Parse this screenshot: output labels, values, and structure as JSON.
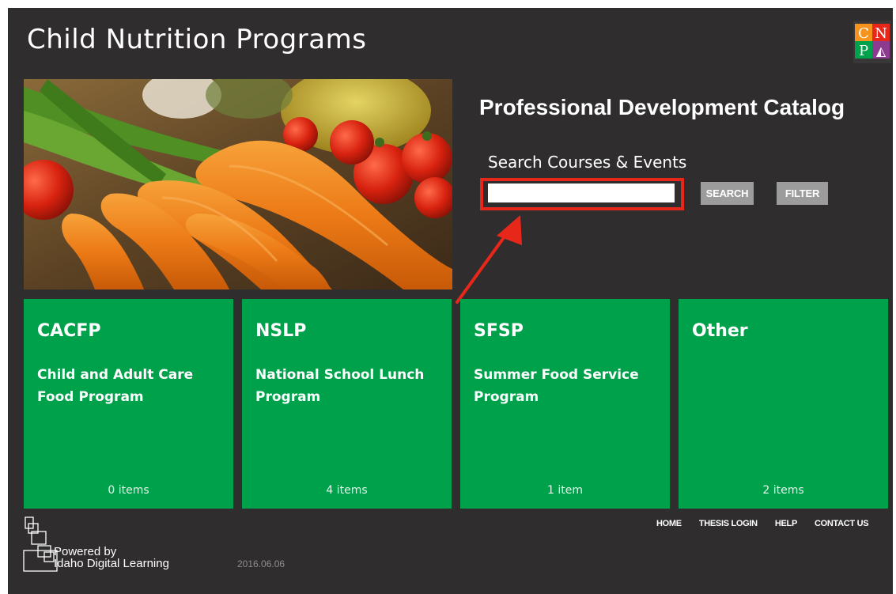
{
  "header": {
    "title": "Child Nutrition Programs"
  },
  "logo": {
    "letters": [
      "C",
      "N",
      "P",
      "◭"
    ]
  },
  "catalog": {
    "title": "Professional Development Catalog"
  },
  "search": {
    "label": "Search Courses & Events",
    "value": "",
    "placeholder": "",
    "search_label": "SEARCH",
    "filter_label": "FILTER"
  },
  "tiles": [
    {
      "code": "CACFP",
      "name": "Child and Adult Care Food Program",
      "count": "0 items"
    },
    {
      "code": "NSLP",
      "name": "National School Lunch Program",
      "count": "4 items"
    },
    {
      "code": "SFSP",
      "name": "Summer Food Service Program",
      "count": "1 item"
    },
    {
      "code": "Other",
      "name": "",
      "count": "2 items"
    }
  ],
  "footer": {
    "powered_line1": "Powered by",
    "powered_line2": "Idaho Digital Learning",
    "version": "2016.06.06",
    "nav": [
      "HOME",
      "THESIS LOGIN",
      "HELP",
      "CONTACT US"
    ]
  },
  "colors": {
    "background": "#2f2d2e",
    "tile": "#00a14b",
    "highlight": "#e8271b",
    "button": "#9c9c9c"
  }
}
